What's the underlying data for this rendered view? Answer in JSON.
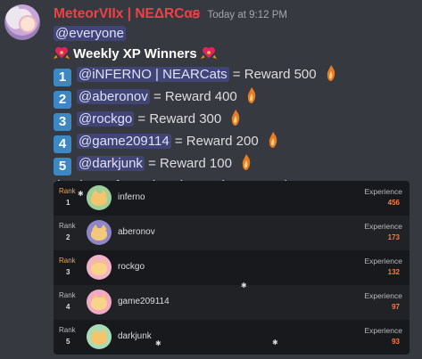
{
  "message": {
    "username": "MeteorVIIx | NEΔRCαꞩ",
    "timestamp": "Today at 9:12 PM",
    "mention_everyone": "@everyone",
    "title": "Weekly XP Winners",
    "winners": [
      {
        "num": "1",
        "mention": "@iNFERNO | NEARCats",
        "text": " = Reward 500"
      },
      {
        "num": "2",
        "mention": "@aberonov",
        "text": " = Reward 400"
      },
      {
        "num": "3",
        "mention": "@rockgo",
        "text": " = Reward 300"
      },
      {
        "num": "4",
        "mention": "@game209114",
        "text": " = Reward 200"
      },
      {
        "num": "5",
        "mention": "@darkjunk",
        "text": " = Reward 100"
      }
    ],
    "footer": "thank you for active chat and command spam."
  },
  "leaderboard": {
    "rank_label": "Rank",
    "exp_label": "Experience",
    "rows": [
      {
        "rank": "1",
        "name": "inferno",
        "exp": "456"
      },
      {
        "rank": "2",
        "name": "aberonov",
        "exp": "173"
      },
      {
        "rank": "3",
        "name": "rockgo",
        "exp": "132"
      },
      {
        "rank": "4",
        "name": "game209114",
        "exp": "97"
      },
      {
        "rank": "5",
        "name": "darkjunk",
        "exp": "93"
      }
    ]
  },
  "colors": {
    "background": "#36393f",
    "username": "#ed4245",
    "mention_bg": "#414675",
    "badge": "#3b88c3",
    "exp_value": "#f37c4a",
    "rank_gold": "#f0a04b"
  },
  "icons": {
    "avatar": "angel-anime-avatar",
    "title_emoji": "heart-ribbon-emoji",
    "reward_emoji": "flame-token-emoji",
    "member_avatar": "cat-avatar"
  }
}
